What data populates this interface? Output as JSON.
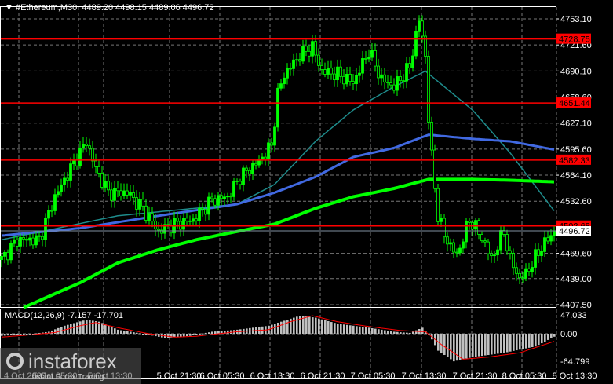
{
  "header": {
    "symbol": "#Ethereum,M30",
    "ohlc": "4489.20 4498.15 4489.06 4496.72"
  },
  "price_axis": {
    "ticks": [
      "4753.10",
      "4721.60",
      "4690.10",
      "4658.60",
      "4627.10",
      "4595.60",
      "4564.10",
      "4532.60",
      "4469.60",
      "4439.00",
      "4407.50"
    ],
    "tick_values": [
      4753.1,
      4721.6,
      4690.1,
      4658.6,
      4627.1,
      4595.6,
      4564.1,
      4532.6,
      4469.6,
      4439.0,
      4407.5
    ],
    "current_price": "4496.72",
    "current_value": 4496.72
  },
  "levels": [
    {
      "label": "4728.75",
      "value": 4728.75
    },
    {
      "label": "4651.44",
      "value": 4651.44
    },
    {
      "label": "4582.33",
      "value": 4582.33
    },
    {
      "label": "4502.68",
      "value": 4502.68
    }
  ],
  "time_axis": [
    "4 Oct 2025",
    "5 Oct 05:30",
    "5 Oct 13:30",
    "5 Oct 21:30",
    "6 Oct 05:30",
    "6 Oct 13:30",
    "6 Oct 21:30",
    "7 Oct 05:30",
    "7 Oct 13:30",
    "7 Oct 21:30",
    "8 Oct 05:30",
    "8 Oct 13:30"
  ],
  "macd": {
    "label": "MACD(12,26,9) -7.157 -17.701",
    "ticks": [
      "47.033",
      "0.00",
      "-64.799"
    ],
    "hist_keys": [
      [
        0,
        -5
      ],
      [
        10,
        0
      ],
      [
        15,
        5
      ],
      [
        20,
        20
      ],
      [
        27,
        35
      ],
      [
        31,
        30
      ],
      [
        37,
        10
      ],
      [
        45,
        0
      ],
      [
        52,
        -10
      ],
      [
        60,
        -5
      ],
      [
        67,
        5
      ],
      [
        75,
        10
      ],
      [
        85,
        20
      ],
      [
        95,
        45
      ],
      [
        100,
        40
      ],
      [
        107,
        25
      ],
      [
        117,
        15
      ],
      [
        125,
        5
      ],
      [
        130,
        2
      ],
      [
        134,
        15
      ],
      [
        136,
        0
      ],
      [
        139,
        -40
      ],
      [
        144,
        -65
      ],
      [
        150,
        -55
      ],
      [
        160,
        -45
      ],
      [
        170,
        -30
      ],
      [
        176,
        -7
      ]
    ],
    "signal_keys": [
      [
        0,
        -8
      ],
      [
        10,
        -2
      ],
      [
        17,
        3
      ],
      [
        25,
        20
      ],
      [
        30,
        28
      ],
      [
        37,
        15
      ],
      [
        47,
        0
      ],
      [
        55,
        -8
      ],
      [
        62,
        -6
      ],
      [
        75,
        5
      ],
      [
        85,
        10
      ],
      [
        92,
        30
      ],
      [
        99,
        45
      ],
      [
        107,
        30
      ],
      [
        117,
        18
      ],
      [
        127,
        8
      ],
      [
        135,
        5
      ],
      [
        140,
        -25
      ],
      [
        147,
        -60
      ],
      [
        155,
        -55
      ],
      [
        165,
        -45
      ],
      [
        176,
        -18
      ]
    ]
  },
  "colors": {
    "bull": "#00ff00",
    "level": "#ff0000",
    "ma_fast": "#1e8c8c",
    "ma_mid": "#4169e1",
    "ma_slow": "#00ff00",
    "macd_hist": "#c0c0c0",
    "macd_signal": "#ff0000"
  },
  "price_keys": [
    [
      0,
      4462
    ],
    [
      5,
      4486
    ],
    [
      12,
      4486
    ],
    [
      17,
      4538
    ],
    [
      22,
      4572
    ],
    [
      27,
      4605
    ],
    [
      30,
      4572
    ],
    [
      34,
      4543
    ],
    [
      40,
      4543
    ],
    [
      45,
      4524
    ],
    [
      50,
      4496
    ],
    [
      55,
      4505
    ],
    [
      61,
      4510
    ],
    [
      67,
      4534
    ],
    [
      72,
      4538
    ],
    [
      76,
      4562
    ],
    [
      82,
      4581
    ],
    [
      86,
      4600
    ],
    [
      88,
      4662
    ],
    [
      90,
      4686
    ],
    [
      95,
      4709
    ],
    [
      99,
      4719
    ],
    [
      102,
      4690
    ],
    [
      107,
      4686
    ],
    [
      112,
      4676
    ],
    [
      117,
      4714
    ],
    [
      121,
      4680
    ],
    [
      125,
      4671
    ],
    [
      130,
      4695
    ],
    [
      133,
      4752
    ],
    [
      135,
      4709
    ],
    [
      136,
      4633
    ],
    [
      137,
      4586
    ],
    [
      139,
      4515
    ],
    [
      141,
      4491
    ],
    [
      145,
      4467
    ],
    [
      149,
      4510
    ],
    [
      151,
      4501
    ],
    [
      154,
      4481
    ],
    [
      156,
      4462
    ],
    [
      160,
      4496
    ],
    [
      162,
      4462
    ],
    [
      165,
      4439
    ],
    [
      167,
      4445
    ],
    [
      172,
      4477
    ],
    [
      176,
      4496
    ]
  ],
  "ma_fast_keys": [
    [
      0,
      4486
    ],
    [
      37,
      4515
    ],
    [
      75,
      4529
    ],
    [
      87,
      4553
    ],
    [
      100,
      4605
    ],
    [
      112,
      4643
    ],
    [
      125,
      4671
    ],
    [
      135,
      4690
    ],
    [
      150,
      4643
    ],
    [
      162,
      4591
    ],
    [
      176,
      4521
    ]
  ],
  "ma_mid_keys": [
    [
      0,
      4491
    ],
    [
      25,
      4500
    ],
    [
      50,
      4515
    ],
    [
      75,
      4529
    ],
    [
      87,
      4543
    ],
    [
      100,
      4562
    ],
    [
      112,
      4586
    ],
    [
      125,
      4597
    ],
    [
      136,
      4613
    ],
    [
      150,
      4608
    ],
    [
      162,
      4605
    ],
    [
      176,
      4595
    ]
  ],
  "ma_slow_keys": [
    [
      7,
      4404
    ],
    [
      25,
      4434
    ],
    [
      37,
      4458
    ],
    [
      50,
      4474
    ],
    [
      62,
      4486
    ],
    [
      75,
      4496
    ],
    [
      87,
      4505
    ],
    [
      100,
      4524
    ],
    [
      112,
      4538
    ],
    [
      125,
      4548
    ],
    [
      136,
      4559
    ],
    [
      150,
      4559
    ],
    [
      162,
      4558
    ],
    [
      176,
      4556
    ]
  ]
}
